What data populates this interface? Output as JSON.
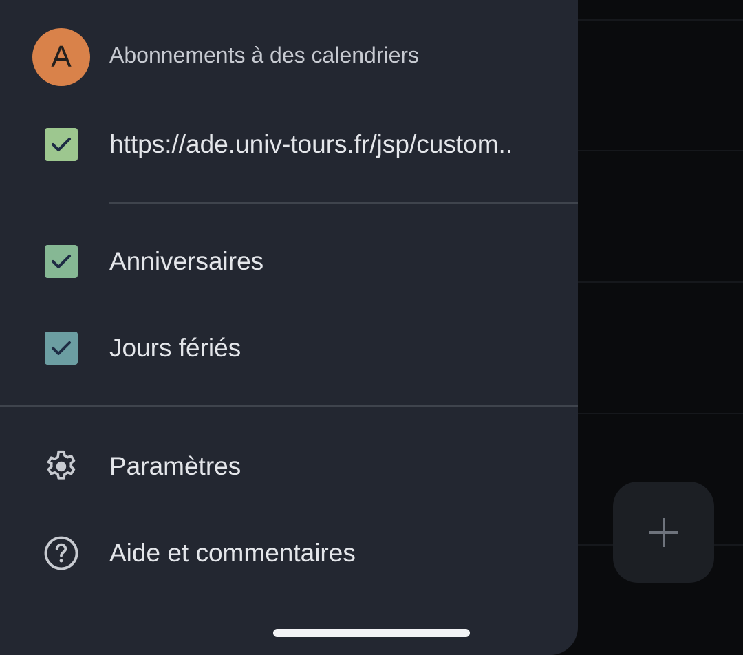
{
  "drawer": {
    "subscriptions_section": {
      "avatar_letter": "A",
      "avatar_color": "#d9824a",
      "title": "Abonnements à des calendriers"
    },
    "calendars": [
      {
        "label": "https://ade.univ-tours.fr/jsp/custom..",
        "checked": true,
        "color": "#9dc78f"
      },
      {
        "label": "Anniversaires",
        "checked": true,
        "color": "#86b894"
      },
      {
        "label": "Jours fériés",
        "checked": true,
        "color": "#6c9ea2"
      }
    ],
    "menu": [
      {
        "label": "Paramètres",
        "icon": "gear-icon"
      },
      {
        "label": "Aide et commentaires",
        "icon": "help-icon"
      }
    ]
  },
  "fab": {
    "icon": "plus-icon"
  }
}
